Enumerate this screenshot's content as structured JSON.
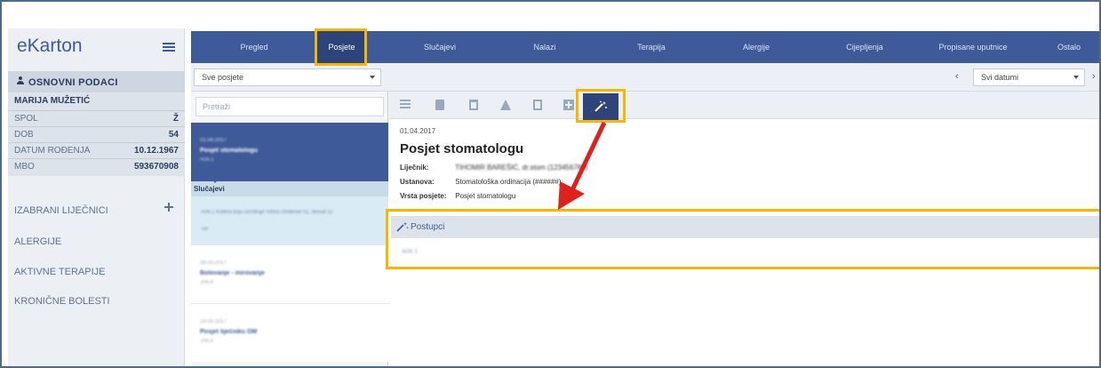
{
  "app": {
    "logo": "eKarton"
  },
  "patient": {
    "section_title": "OSNOVNI PODACI",
    "name": "MARIJA MUŽETIĆ",
    "fields": [
      {
        "label": "SPOL",
        "value": "Ž"
      },
      {
        "label": "DOB",
        "value": "54"
      },
      {
        "label": "DATUM ROĐENJA",
        "value": "10.12.1967"
      },
      {
        "label": "MBO",
        "value": "593670908"
      }
    ]
  },
  "sidebar": {
    "items": [
      {
        "label": "IZABRANI LIJEČNICI"
      },
      {
        "label": "ALERGIJE"
      },
      {
        "label": "AKTIVNE TERAPIJE"
      },
      {
        "label": "KRONIČNE BOLESTI"
      }
    ]
  },
  "topnav": {
    "tabs": [
      {
        "label": "Pregled"
      },
      {
        "label": "Posjete"
      },
      {
        "label": "Slučajevi"
      },
      {
        "label": "Nalazi"
      },
      {
        "label": "Terapija"
      },
      {
        "label": "Alergije"
      },
      {
        "label": "Cijepljenja"
      },
      {
        "label": "Propisane uputnice"
      },
      {
        "label": "Ostalo"
      }
    ],
    "active": "Posjete"
  },
  "filters": {
    "visit_filter": "Sve posjete",
    "date_filter": "Svi datumi",
    "prev_arrow": "‹",
    "next_arrow": "›"
  },
  "search": {
    "placeholder": "Pretraži"
  },
  "visits": [
    {
      "date": "01.04.2017",
      "title": "Posjet stomatologu",
      "code": "A06.1"
    },
    {
      "date": "28.03.2017",
      "title": "Bolovanje - mirovanje",
      "code": "J06.9"
    },
    {
      "date": "14.03.2017",
      "title": "Posjet liječniku OM",
      "code": "J06.9"
    }
  ],
  "cases": {
    "header": "Slučajevi",
    "item_text": "A06.1 Kolera koju uzrokuje Vibrio cholerae 01, biovar El",
    "item_text2": "Tor"
  },
  "detail": {
    "date": "01.04.2017",
    "title": "Posjet stomatologu",
    "fields": [
      {
        "label": "Liječnik:",
        "value": "TIHOMIR BAREŠIĆ, dr.stom (123456789)"
      },
      {
        "label": "Ustanova:",
        "value": "Stomatološka ordinacija (######)"
      },
      {
        "label": "Vrsta posjete:",
        "value": "Posjet stomatologu"
      }
    ],
    "section": "Postupci",
    "procedure": "A06.1"
  },
  "colors": {
    "nav": "#3e5a99",
    "nav_active": "#2d447a",
    "highlight": "#f5b800",
    "arrow": "#e0201b"
  }
}
